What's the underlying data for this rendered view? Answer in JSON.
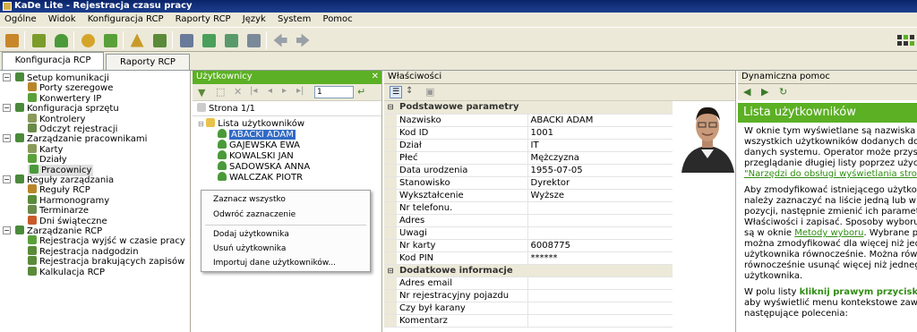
{
  "window": {
    "title": "KaDe Lite - Rejestracja czasu pracy"
  },
  "menu": [
    "Ogólne",
    "Widok",
    "Konfiguracja RCP",
    "Raporty RCP",
    "Język",
    "System",
    "Pomoc"
  ],
  "toolbar": {
    "icons": [
      "notebook-icon",
      "home-icon",
      "person-icon",
      "clock-icon",
      "briefcase-icon",
      "scale-icon",
      "calculator-icon",
      "printer-icon",
      "map-icon",
      "search-doc-icon",
      "calendar-icon",
      "back-arrow-icon",
      "forward-arrow-icon"
    ],
    "colors": [
      "#c8862a",
      "#7a9c2a",
      "#4a9a3a",
      "#d5a52a",
      "#5aa03a",
      "#c89a2a",
      "#5a8a3a",
      "#6a7a9a",
      "#4aa05a",
      "#5a9a6a",
      "#7a8a9a",
      "#9aa0a8",
      "#9aa0a8"
    ]
  },
  "tabs": [
    {
      "label": "Konfiguracja RCP"
    },
    {
      "label": "Raporty RCP"
    }
  ],
  "nav_tree": [
    {
      "label": "Setup komunikacji",
      "level": 0,
      "color": "#4a8a3a"
    },
    {
      "label": "Porty szeregowe",
      "level": 1,
      "color": "#b8862a"
    },
    {
      "label": "Konwertery IP",
      "level": 1,
      "color": "#5aa03a"
    },
    {
      "label": "Konfiguracja sprzętu",
      "level": 0,
      "color": "#4a8a3a"
    },
    {
      "label": "Kontrolery",
      "level": 1,
      "color": "#8a9a5a"
    },
    {
      "label": "Odczyt rejestracji",
      "level": 1,
      "color": "#6a8a4a"
    },
    {
      "label": "Zarządzanie pracownikami",
      "level": 0,
      "color": "#4a8a3a"
    },
    {
      "label": "Karty",
      "level": 1,
      "color": "#8a9a5a"
    },
    {
      "label": "Działy",
      "level": 1,
      "color": "#5aa03a"
    },
    {
      "label": "Pracownicy",
      "level": 1,
      "color": "#4a9a3a",
      "selected": true
    },
    {
      "label": "Reguły zarządzania",
      "level": 0,
      "color": "#4a8a3a"
    },
    {
      "label": "Reguły RCP",
      "level": 1,
      "color": "#b8862a"
    },
    {
      "label": "Harmonogramy",
      "level": 1,
      "color": "#5a8a3a"
    },
    {
      "label": "Terminarze",
      "level": 1,
      "color": "#6a8a4a"
    },
    {
      "label": "Dni świąteczne",
      "level": 1,
      "color": "#c85a2a"
    },
    {
      "label": "Zarządzanie RCP",
      "level": 0,
      "color": "#4a8a3a"
    },
    {
      "label": "Rejestracja wyjść w czasie pracy",
      "level": 1,
      "color": "#5aa03a"
    },
    {
      "label": "Rejestracja nadgodzin",
      "level": 1,
      "color": "#5a8a3a"
    },
    {
      "label": "Rejestracja brakujących zapisów",
      "level": 1,
      "color": "#5a8a3a"
    },
    {
      "label": "Kalkulacja RCP",
      "level": 1,
      "color": "#5a8a3a"
    }
  ],
  "users_panel": {
    "title": "Użytkownicy",
    "page_input": "1",
    "page_label": "Strona 1/1",
    "root": "Lista użytkowników",
    "users": [
      "ABACKI ADAM",
      "GAJEWSKA EWA",
      "KOWALSKI JAN",
      "SADOWSKA ANNA",
      "WALCZAK PIOTR"
    ],
    "context_menu": [
      "Zaznacz wszystko",
      "Odwróć zaznaczenie",
      "Dodaj użytkownika",
      "Usuń użytkownika",
      "Importuj dane użytkowników..."
    ]
  },
  "props_panel": {
    "title": "Właściwości",
    "section1": "Podstawowe parametry",
    "rows1": [
      {
        "name": "Nazwisko",
        "value": "ABACKI ADAM"
      },
      {
        "name": "Kod ID",
        "value": "1001"
      },
      {
        "name": "Dział",
        "value": "IT"
      },
      {
        "name": "Płeć",
        "value": "Mężczyzna"
      },
      {
        "name": "Data urodzenia",
        "value": "1955-07-05"
      },
      {
        "name": "Stanowisko",
        "value": "Dyrektor"
      },
      {
        "name": "Wykształcenie",
        "value": "Wyższe"
      },
      {
        "name": "Nr telefonu.",
        "value": ""
      },
      {
        "name": "Adres",
        "value": ""
      },
      {
        "name": "Uwagi",
        "value": ""
      },
      {
        "name": "Nr karty",
        "value": "6008775"
      },
      {
        "name": "Kod PIN",
        "value": "******"
      }
    ],
    "section2": "Dodatkowe informacje",
    "rows2": [
      {
        "name": "Adres email",
        "value": ""
      },
      {
        "name": "Nr rejestracyjny pojazdu",
        "value": ""
      },
      {
        "name": "Czy był karany",
        "value": ""
      },
      {
        "name": "Komentarz",
        "value": ""
      }
    ]
  },
  "help_panel": {
    "title": "Dynamiczna pomoc",
    "heading": "Lista użytkowników",
    "p1": [
      "W oknie tym wyświetlane są nazwiska",
      "wszystkich użytkowników dodanych do b",
      "danych systemu. Operator może przyspie",
      "przeglądanie długiej listy poprzez użycie"
    ],
    "p1_link": "\"Narzędzi do obsługi wyświetlania strony",
    "p2a": [
      "Aby zmodyfikować istniejącego użytkown",
      "należy zaznaczyć na liście jedną lub więc",
      "pozycji, następnie zmienić ich parametry",
      "Właściwości i zapisać. Sposoby wyboru o"
    ],
    "p2_prefix": "są w oknie ",
    "p2_link": "Metody wyboru",
    "p2_suffix": ". Wybrane par",
    "p2b": [
      "można zmodyfikować dla więcej niż jedne",
      "użytkownika równocześnie. Można równ",
      "równocześnie usunąć więcej niż jednego",
      "użytkownika."
    ],
    "p3_prefix": "W polu listy ",
    "p3_strong": "kliknij prawym przyciskiem",
    "p3b": [
      "aby wyświetlić menu kontekstowe zawie",
      "następujące polecenia:"
    ]
  }
}
